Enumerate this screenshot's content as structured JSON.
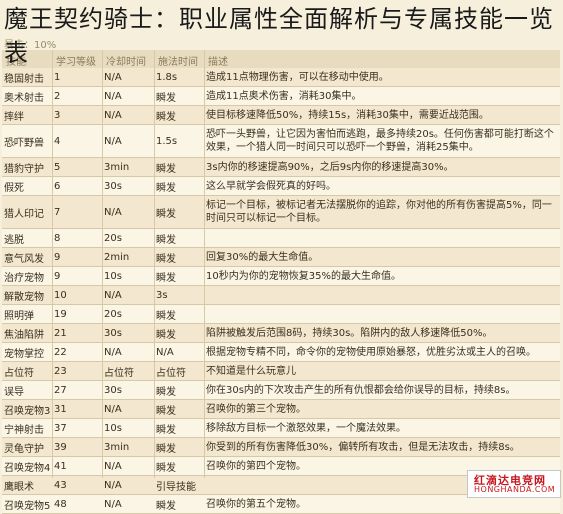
{
  "title": "魔王契约骑士：职业属性全面解析与专属技能一览表",
  "banner_note": "暴击：10%",
  "headers": {
    "name": "技能",
    "level": "学习等级",
    "cooldown": "冷却时间",
    "cast": "施法时间",
    "desc": "描述"
  },
  "rows": [
    {
      "name": "稳固射击",
      "level": "1",
      "cooldown": "N/A",
      "cast": "1.8s",
      "desc": "造成11点物理伤害，可以在移动中使用。"
    },
    {
      "name": "奥术射击",
      "level": "2",
      "cooldown": "N/A",
      "cast": "瞬发",
      "desc": "造成11点奥术伤害，消耗30集中。"
    },
    {
      "name": "摔绊",
      "level": "3",
      "cooldown": "N/A",
      "cast": "瞬发",
      "desc": "使目标移速降低50%，持续15s，消耗30集中，需要近战范围。"
    },
    {
      "name": "恐吓野兽",
      "level": "4",
      "cooldown": "N/A",
      "cast": "1.5s",
      "desc": "恐吓一头野兽，让它因为害怕而逃跑，最多持续20s。任何伤害都可能打断这个效果，一个猎人同一时间只可以恐吓一个野兽，消耗25集中。"
    },
    {
      "name": "猎豹守护",
      "level": "5",
      "cooldown": "3min",
      "cast": "瞬发",
      "desc": "3s内你的移速提高90%，之后9s内你的移速提高30%。"
    },
    {
      "name": "假死",
      "level": "6",
      "cooldown": "30s",
      "cast": "瞬发",
      "desc": "这么早就学会假死真的好吗。"
    },
    {
      "name": "猎人印记",
      "level": "7",
      "cooldown": "N/A",
      "cast": "瞬发",
      "desc": "标记一个目标，被标记者无法摆脱你的追踪，你对他的所有伤害提高5%，同一时间只可以标记一个目标。"
    },
    {
      "name": "逃脱",
      "level": "8",
      "cooldown": "20s",
      "cast": "瞬发",
      "desc": ""
    },
    {
      "name": "意气风发",
      "level": "9",
      "cooldown": "2min",
      "cast": "瞬发",
      "desc": "回复30%的最大生命值。"
    },
    {
      "name": "治疗宠物",
      "level": "9",
      "cooldown": "10s",
      "cast": "瞬发",
      "desc": "10秒内为你的宠物恢复35%的最大生命值。"
    },
    {
      "name": "解散宠物",
      "level": "10",
      "cooldown": "N/A",
      "cast": "3s",
      "desc": ""
    },
    {
      "name": "照明弹",
      "level": "19",
      "cooldown": "20s",
      "cast": "瞬发",
      "desc": ""
    },
    {
      "name": "焦油陷阱",
      "level": "21",
      "cooldown": "30s",
      "cast": "瞬发",
      "desc": "陷阱被触发后范围8码，持续30s。陷阱内的敌人移速降低50%。"
    },
    {
      "name": "宠物掌控",
      "level": "22",
      "cooldown": "N/A",
      "cast": "N/A",
      "desc": "根据宠物专精不同，命令你的宠物使用原始暴怒，优胜劣汰或主人的召唤。"
    },
    {
      "name": "占位符",
      "level": "23",
      "cooldown": "占位符",
      "cast": "占位符",
      "desc": "不知道是什么玩意儿"
    },
    {
      "name": "误导",
      "level": "27",
      "cooldown": "30s",
      "cast": "瞬发",
      "desc": "你在30s内的下次攻击产生的所有仇恨都会给你误导的目标，持续8s。"
    },
    {
      "name": "召唤宠物3",
      "level": "31",
      "cooldown": "N/A",
      "cast": "瞬发",
      "desc": "召唤你的第三个宠物。"
    },
    {
      "name": "宁神射击",
      "level": "37",
      "cooldown": "10s",
      "cast": "瞬发",
      "desc": "移除敌方目标一个激怒效果，一个魔法效果。"
    },
    {
      "name": "灵龟守护",
      "level": "39",
      "cooldown": "3min",
      "cast": "瞬发",
      "desc": "你受到的所有伤害降低30%，偏转所有攻击，但是无法攻击，持续8s。"
    },
    {
      "name": "召唤宠物4",
      "level": "41",
      "cooldown": "N/A",
      "cast": "瞬发",
      "desc": "召唤你的第四个宠物。"
    },
    {
      "name": "鹰眼术",
      "level": "43",
      "cooldown": "N/A",
      "cast": "引导技能",
      "desc": ""
    },
    {
      "name": "召唤宠物5",
      "level": "48",
      "cooldown": "N/A",
      "cast": "瞬发",
      "desc": "召唤你的第五个宠物。"
    }
  ],
  "watermark": {
    "cn": "红滴达电竞网",
    "en": "HONGHANDA.COM"
  }
}
